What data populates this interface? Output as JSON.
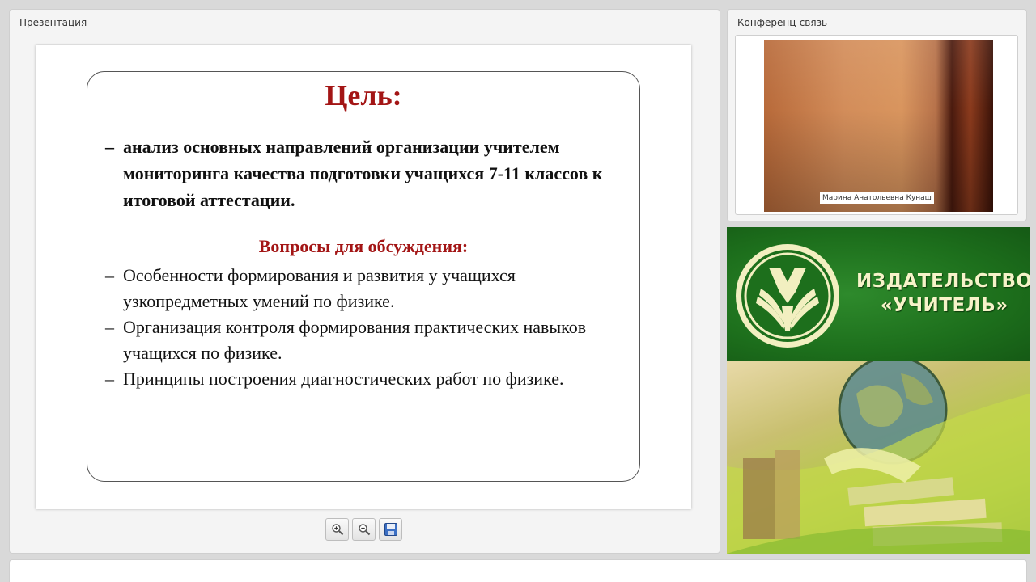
{
  "presentation": {
    "title": "Презентация",
    "slide": {
      "heading": "Цель:",
      "goal_dash": "–",
      "goal_text": "анализ основных направлений организации учителем мониторинга качества подготовки учащихся 7-11 классов к итоговой аттестации.",
      "subheading": "Вопросы для обсуждения:",
      "questions": [
        "Особенности формирования и развития у учащихся узкопредметных умений по физике.",
        "Организация контроля формирования практических навыков учащихся по физике.",
        "Принципы построения диагностических работ по физике."
      ],
      "dash": "–",
      "colors": {
        "heading": "#a31515",
        "text": "#111111"
      }
    },
    "toolbar": {
      "buttons": [
        {
          "name": "zoom-in",
          "icon": "zoom-in-icon"
        },
        {
          "name": "zoom-out",
          "icon": "zoom-out-icon"
        },
        {
          "name": "save",
          "icon": "save-icon"
        }
      ]
    }
  },
  "conference": {
    "title": "Конференц-связь",
    "participant_name": "Марина Анатольевна Кунаш"
  },
  "publisher": {
    "line1": "ИЗДАТЕЛЬСТВО",
    "line2": "«УЧИТЕЛЬ»",
    "colors": {
      "green": "#1d6f1c",
      "text": "#f7f3c9"
    }
  }
}
